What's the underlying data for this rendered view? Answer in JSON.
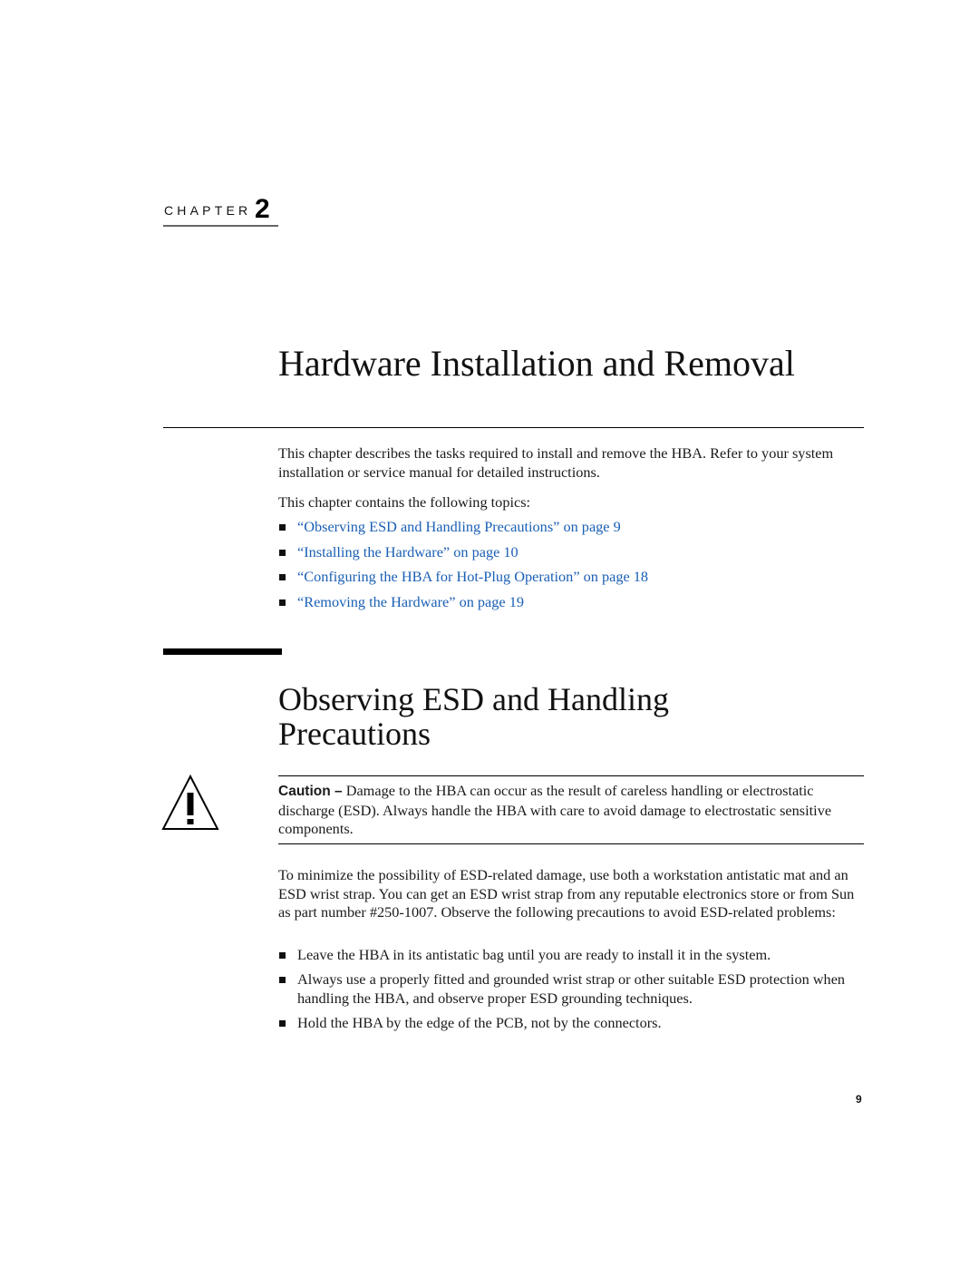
{
  "chapter": {
    "label": "CHAPTER",
    "number": "2",
    "title": "Hardware Installation and Removal"
  },
  "intro": {
    "paragraph1": "This chapter describes the tasks required to install and remove the HBA. Refer to your system installation or service manual for detailed instructions.",
    "paragraph2": "This chapter contains the following topics:",
    "topics": [
      {
        "label": "“Observing ESD and Handling Precautions” on page 9"
      },
      {
        "label": "“Installing the Hardware” on page 10"
      },
      {
        "label": "“Configuring the HBA for Hot-Plug Operation” on page 18"
      },
      {
        "label": "“Removing the Hardware” on page 19"
      }
    ]
  },
  "section": {
    "title": "Observing ESD and Handling Precautions",
    "caution": {
      "icon": "warning-triangle-icon",
      "label": "Caution –",
      "text": " Damage to the HBA can occur as the result of careless handling or electrostatic discharge (ESD). Always handle the HBA with care to avoid damage to electrostatic sensitive components."
    },
    "paragraph": "To minimize the possibility of ESD-related damage, use both a workstation antistatic mat and an ESD wrist strap. You can get an ESD wrist strap from any reputable electronics store or from Sun as part number #250-1007. Observe the following precautions to avoid ESD-related problems:",
    "precautions": [
      {
        "text": "Leave the HBA in its antistatic bag until you are ready to install it in the system."
      },
      {
        "text": "Always use a properly fitted and grounded wrist strap or other suitable ESD protection when handling the HBA, and observe proper ESD grounding techniques."
      },
      {
        "text": "Hold the HBA by the edge of the PCB, not by the connectors."
      }
    ]
  },
  "footer": {
    "page_number": "9"
  },
  "colors": {
    "link": "#1a5fb4",
    "text": "#1a1a1a"
  }
}
